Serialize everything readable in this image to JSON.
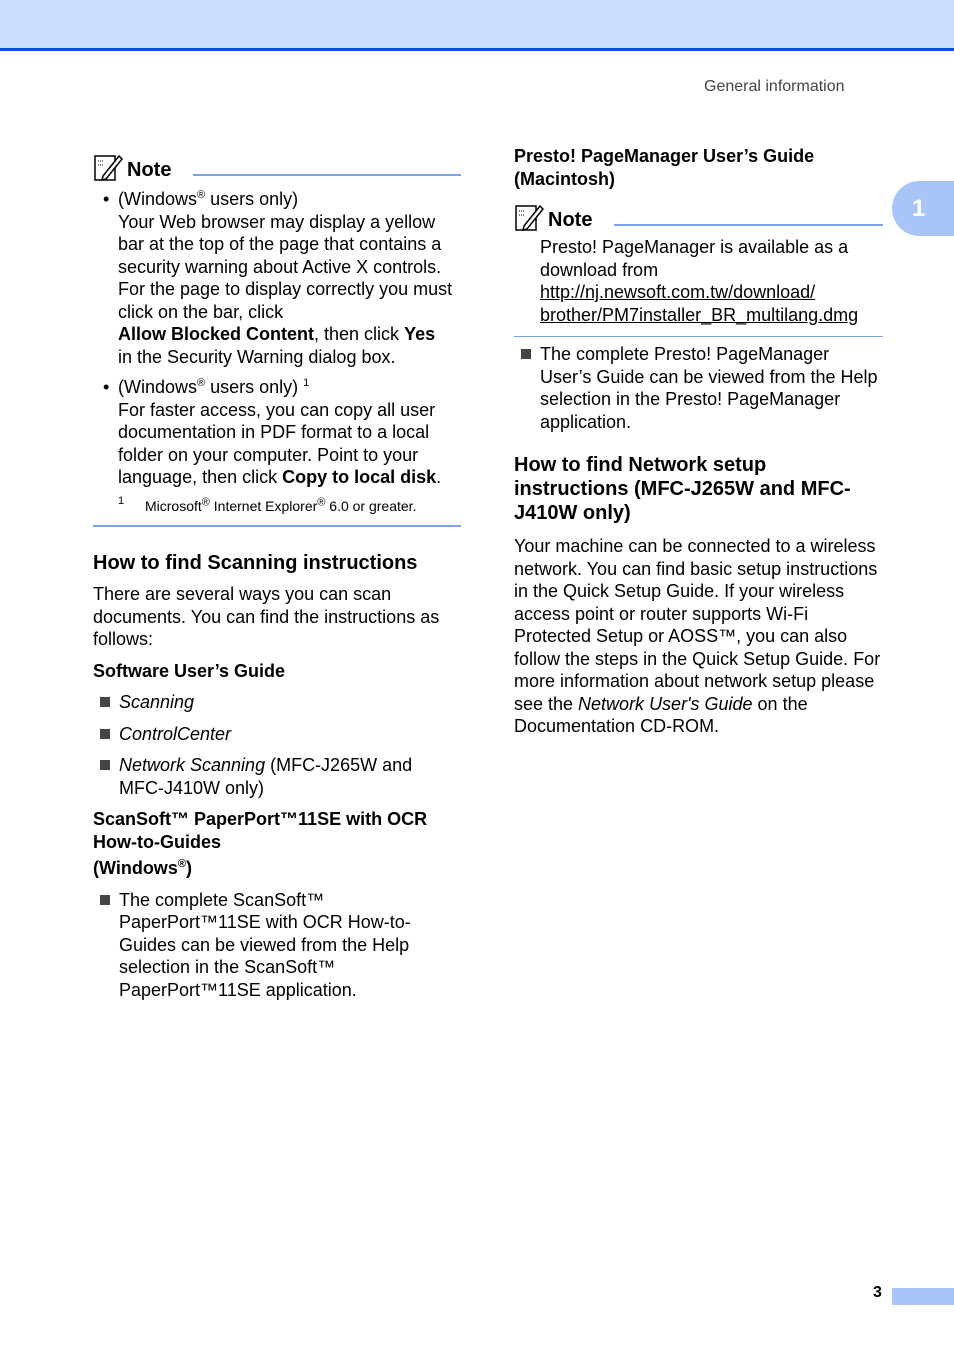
{
  "header": {
    "running_title": "General information",
    "chapter_tab": "1"
  },
  "footer": {
    "page_number": "3"
  },
  "left": {
    "note": {
      "title": "Note",
      "items": [
        {
          "prefix": "(Windows",
          "reg": "®",
          "suffix": " users only)",
          "body": "Your Web browser may display a yellow bar at the top of the page that contains a security warning about Active X controls. For the page to display correctly you must click on the bar, click",
          "bold1": "Allow Blocked Content",
          "mid": ", then click ",
          "bold2": "Yes",
          "tail": "in the Security Warning dialog box."
        },
        {
          "prefix": "(Windows",
          "reg": "®",
          "suffix": " users only) ",
          "fnref": "1",
          "body": "For faster access, you can copy all user documentation in PDF format to a local folder on your computer. Point to your language, then click ",
          "bold": "Copy to local disk",
          "tail": "."
        }
      ],
      "footnote": {
        "num": "1",
        "a": "Microsoft",
        "reg1": "®",
        "b": " Internet Explorer",
        "reg2": "®",
        "c": " 6.0 or greater."
      }
    },
    "scan_heading": "How to find Scanning instructions",
    "scan_intro": "There are several ways you can scan documents. You can find the instructions as follows:",
    "software_guide_heading": "Software User’s Guide",
    "software_items": [
      {
        "italic": "Scanning",
        "rest": ""
      },
      {
        "italic": "ControlCenter",
        "rest": ""
      },
      {
        "italic": "Network Scanning",
        "rest": " (MFC-J265W and MFC-J410W only)"
      }
    ],
    "scansoft_heading_1": "ScanSoft™ PaperPort™11SE with OCR How-to-Guides",
    "scansoft_heading_2": "(Windows",
    "scansoft_heading_reg": "®",
    "scansoft_heading_3": ")",
    "scansoft_item": "The complete ScanSoft™ PaperPort™11SE with OCR How-to-Guides can be viewed from the Help selection in the ScanSoft™ PaperPort™11SE application."
  },
  "right": {
    "presto_heading": "Presto! PageManager User’s Guide (Macintosh)",
    "note": {
      "title": "Note",
      "text": "Presto! PageManager is available as a download from",
      "link_line1": "http://nj.newsoft.com.tw/download/",
      "link_line2": "brother/PM7installer_BR_multilang.dmg"
    },
    "presto_item": "The complete Presto! PageManager User’s Guide can be viewed from the Help selection in the Presto! PageManager application.",
    "network_heading": "How to find Network setup instructions (MFC-J265W and MFC-J410W only)",
    "network_body_1": "Your machine can be connected to a wireless network. You can find basic setup instructions in the Quick Setup Guide. If your wireless access point or router supports Wi-Fi Protected Setup or AOSS™, you can also follow the steps in the Quick Setup Guide. For more information about network setup please see the ",
    "network_body_italic": "Network User's Guide",
    "network_body_2": " on the Documentation CD-ROM."
  }
}
